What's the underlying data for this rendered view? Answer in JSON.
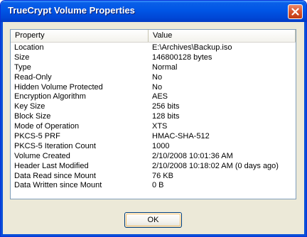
{
  "window": {
    "title": "TrueCrypt Volume Properties"
  },
  "list": {
    "headers": [
      "Property",
      "Value"
    ],
    "rows": [
      [
        "Location",
        "E:\\Archives\\Backup.iso"
      ],
      [
        "Size",
        "146800128 bytes"
      ],
      [
        "Type",
        "Normal"
      ],
      [
        "Read-Only",
        "No"
      ],
      [
        "Hidden Volume Protected",
        "No"
      ],
      [
        "Encryption Algorithm",
        "AES"
      ],
      [
        "Key Size",
        "256 bits"
      ],
      [
        "Block Size",
        "128 bits"
      ],
      [
        "Mode of Operation",
        "XTS"
      ],
      [
        "PKCS-5 PRF",
        "HMAC-SHA-512"
      ],
      [
        "PKCS-5 Iteration Count",
        "1000"
      ],
      [
        "Volume Created",
        "2/10/2008 10:01:36 AM"
      ],
      [
        "Header Last Modified",
        "2/10/2008 10:18:02 AM (0 days ago)"
      ],
      [
        "Data Read since Mount",
        "76 KB"
      ],
      [
        "Data Written since Mount",
        "0 B"
      ]
    ]
  },
  "buttons": {
    "ok": "OK"
  },
  "icons": {
    "close": "close-icon"
  },
  "colors": {
    "titlebar": "#0055e5",
    "close_button": "#d8532c",
    "dialog_bg": "#ece9d8"
  }
}
